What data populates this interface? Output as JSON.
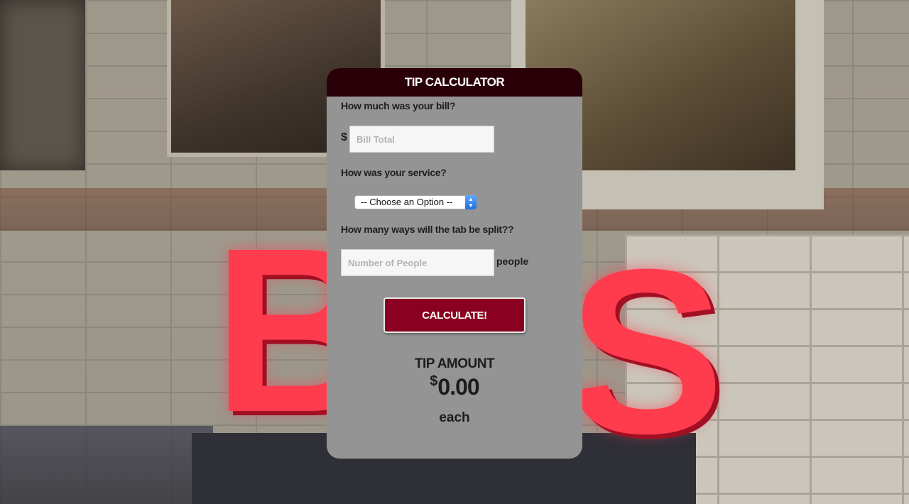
{
  "calculator": {
    "title": "TIP CALCULATOR",
    "bill": {
      "question": "How much was your bill?",
      "currency_symbol": "$",
      "placeholder": "Bill Total",
      "value": ""
    },
    "service": {
      "question": "How was your service?",
      "selected_option": "-- Choose an Option --"
    },
    "split": {
      "question": "How many ways will the tab be split??",
      "placeholder": "Number of People",
      "value": "",
      "unit_label": "people"
    },
    "calculate_label": "CALCULATE!",
    "result": {
      "label": "TIP AMOUNT",
      "currency_symbol": "$",
      "amount": "0.00",
      "suffix": "each"
    }
  },
  "colors": {
    "header_bg": "#2a0008",
    "card_bg": "#949494",
    "button_bg": "#8a0020",
    "sign_red": "#ff3b4e"
  }
}
